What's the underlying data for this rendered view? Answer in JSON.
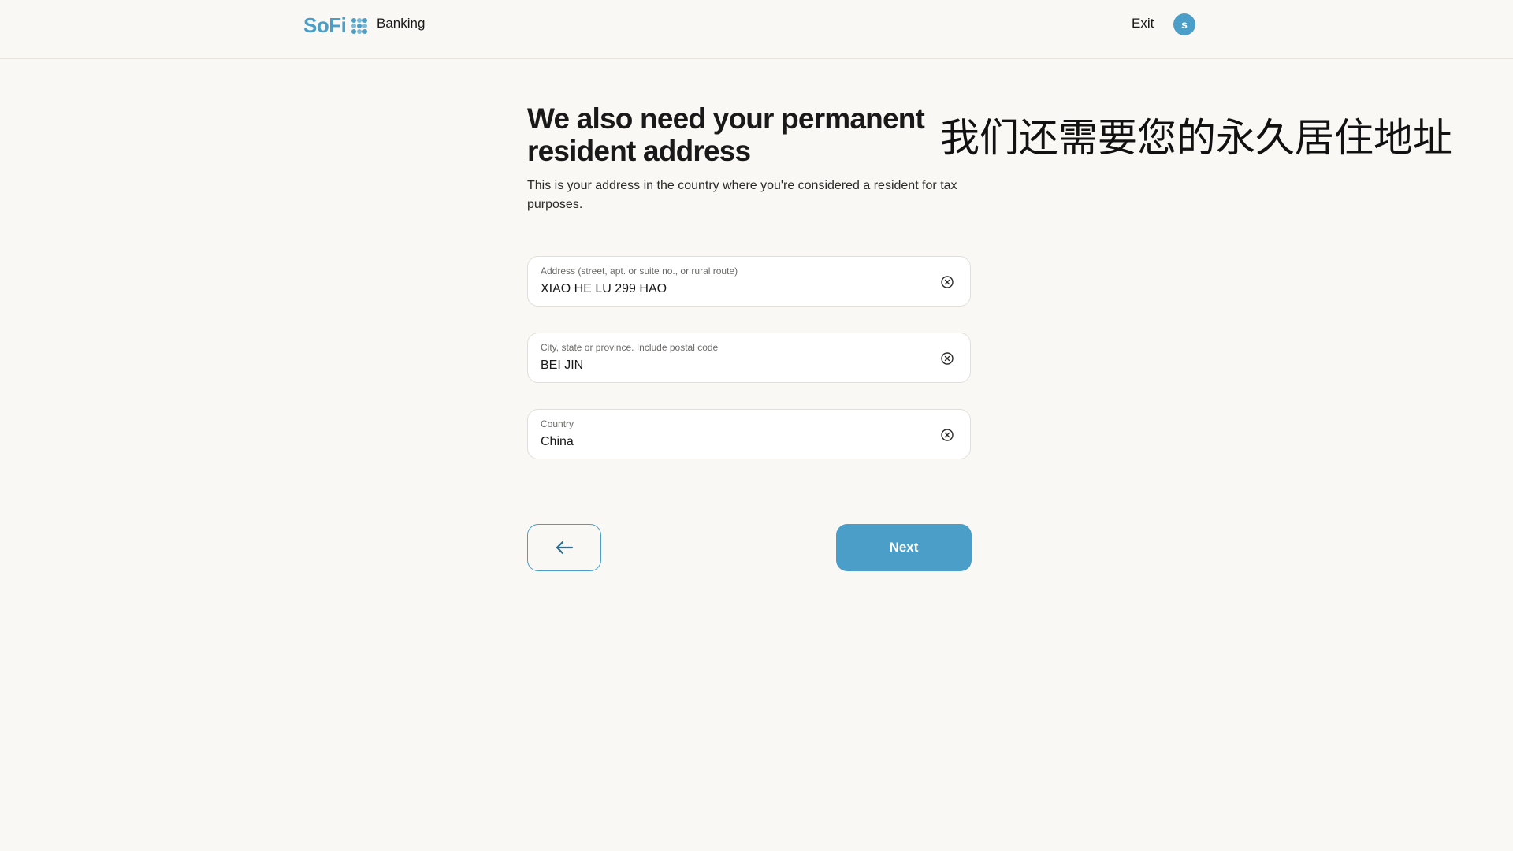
{
  "header": {
    "logo_text": "SoFi",
    "section": "Banking",
    "exit_label": "Exit",
    "avatar_initial": "s"
  },
  "main": {
    "title": "We also need your permanent resident address",
    "overlay_title_cn": "我们还需要您的永久居住地址",
    "subtitle": "This is your address in the country where you're considered a resident for tax purposes."
  },
  "form": {
    "address": {
      "label": "Address (street, apt. or suite no., or rural route)",
      "value": "XIAO HE LU 299 HAO"
    },
    "city": {
      "label": "City, state or province. Include postal code",
      "value": "BEI JIN"
    },
    "country": {
      "label": "Country",
      "value": "China"
    }
  },
  "actions": {
    "next_label": "Next"
  },
  "colors": {
    "brand": "#4a9ec7",
    "background": "#faf8f5",
    "text": "#1a1919"
  }
}
